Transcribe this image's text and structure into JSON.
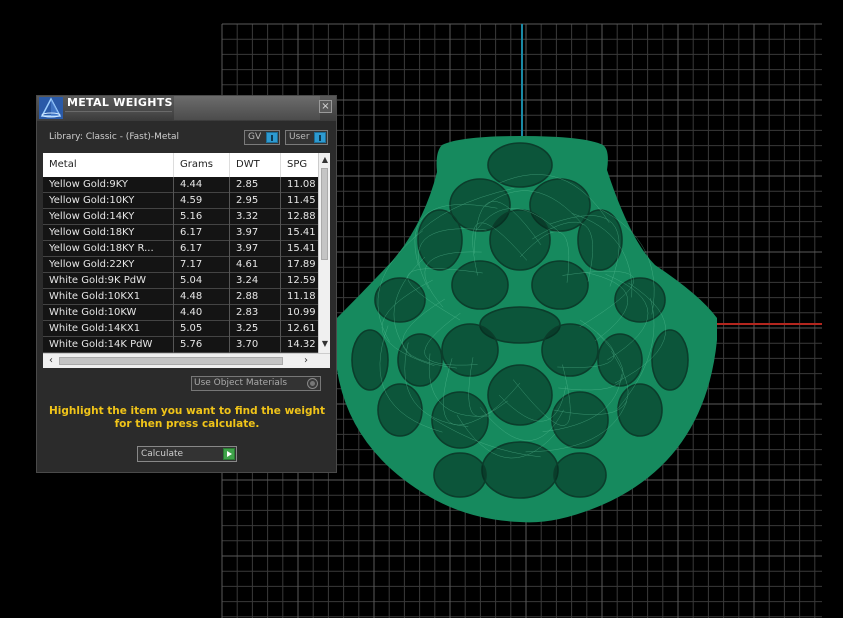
{
  "panel": {
    "title": "METAL WEIGHTS",
    "close_glyph": "×",
    "library_label": "Library: Classic - (Fast)-Metal",
    "toggle_gv": "GV",
    "toggle_user": "User",
    "use_object_materials": "Use Object Materials",
    "instructions_line1": "Highlight the item you want to find the weight",
    "instructions_line2": "for then press calculate.",
    "calculate_label": "Calculate"
  },
  "table": {
    "columns": [
      "Metal",
      "Grams",
      "DWT",
      "SPG"
    ],
    "rows": [
      [
        "Yellow Gold:9KY",
        "4.44",
        "2.85",
        "11.08"
      ],
      [
        "Yellow Gold:10KY",
        "4.59",
        "2.95",
        "11.45"
      ],
      [
        "Yellow Gold:14KY",
        "5.16",
        "3.32",
        "12.88"
      ],
      [
        "Yellow Gold:18KY",
        "6.17",
        "3.97",
        "15.41"
      ],
      [
        "Yellow Gold:18KY R...",
        "6.17",
        "3.97",
        "15.41"
      ],
      [
        "Yellow Gold:22KY",
        "7.17",
        "4.61",
        "17.89"
      ],
      [
        "White Gold:9K PdW",
        "5.04",
        "3.24",
        "12.59"
      ],
      [
        "White Gold:10KX1",
        "4.48",
        "2.88",
        "11.18"
      ],
      [
        "White Gold:10KW",
        "4.40",
        "2.83",
        "10.99"
      ],
      [
        "White Gold:14KX1",
        "5.05",
        "3.25",
        "12.61"
      ],
      [
        "White Gold:14K PdW",
        "5.76",
        "3.70",
        "14.32"
      ]
    ]
  },
  "icons": {
    "logo": "pyramid-logo-icon",
    "close": "close-icon",
    "scroll_up": "chevron-up-icon",
    "scroll_down": "chevron-down-icon",
    "scroll_left": "chevron-left-icon",
    "scroll_right": "chevron-right-icon",
    "calculate": "play-arrow-icon"
  },
  "colors": {
    "model": "#168a5e",
    "axis_y": "#1a8aa6",
    "axis_x": "#b3261e",
    "instructions": "#f0c419",
    "toggle_knob": "#2e9ad0"
  }
}
